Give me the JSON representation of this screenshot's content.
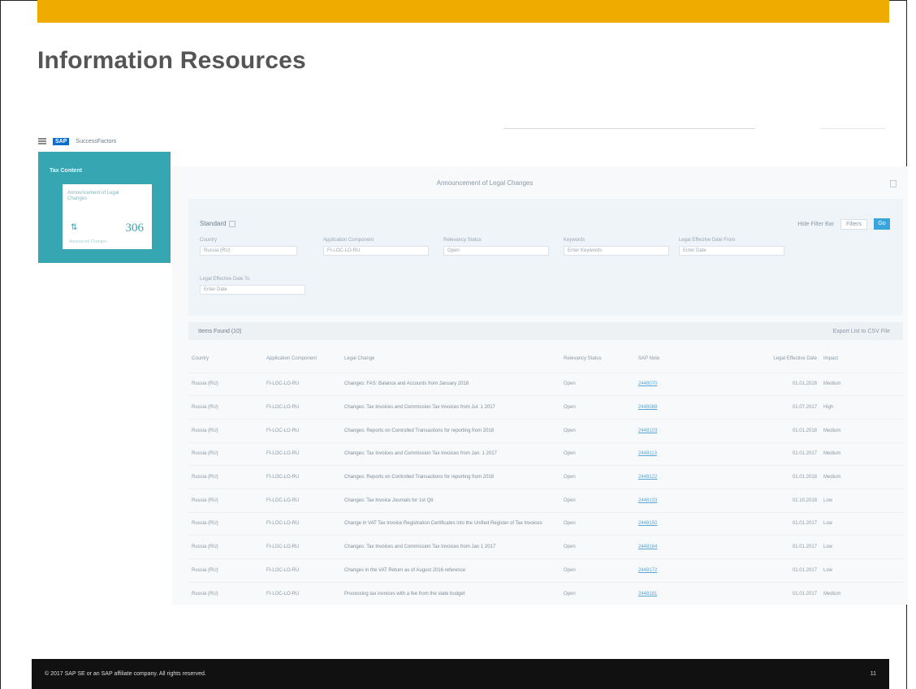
{
  "slide": {
    "title": "Information Resources",
    "footer": "© 2017 SAP SE or an SAP affiliate company. All rights reserved.",
    "page_number": "11"
  },
  "app": {
    "logo": "SAP",
    "name": "SuccessFactors",
    "panel_title": "Announcement of Legal Changes"
  },
  "tile": {
    "title": "Tax Content",
    "subtitle": "Announcement of Legal Changes",
    "count": "306",
    "trend_icon": "trend-arrow-icon",
    "footer": "Announced Changes"
  },
  "filterbar": {
    "variant": "Standard",
    "hide_filter_bar": "Hide Filter Bar",
    "filters_label": "Filters",
    "go_label": "Go",
    "fields": [
      {
        "label": "Country",
        "value": "Russia (RU)"
      },
      {
        "label": "Application Component",
        "value": "FI-LOC-LO-RU"
      },
      {
        "label": "Relevancy Status",
        "value": "Open"
      },
      {
        "label": "Keywords",
        "value": "Enter Keywords"
      },
      {
        "label": "Legal Effective Date From",
        "value": "Enter Date"
      },
      {
        "label": "Legal Effective Date To",
        "value": "Enter Date"
      }
    ]
  },
  "table": {
    "items_found": "Items Found (10)",
    "export": "Export List to CSV File",
    "columns": [
      "Country",
      "Application Component",
      "Legal Change",
      "Relevancy Status",
      "SAP Note",
      "Legal Effective Date",
      "Impact"
    ],
    "rows": [
      [
        "Russia (RU)",
        "FI-LOC-LO-RU",
        "Changes: FAS: Balance and Accounts from January 2018",
        "Open",
        "2448070",
        "01.01.2018",
        "Medium"
      ],
      [
        "Russia (RU)",
        "FI-LOC-LO-RU",
        "Changes: Tax Invoices and Commission Tax Invoices from Jul. 1 2017",
        "Open",
        "2448088",
        "01.07.2017",
        "High"
      ],
      [
        "Russia (RU)",
        "FI-LOC-LO-RU",
        "Changes: Reports on Controlled Transactions for reporting from 2018",
        "Open",
        "2448103",
        "01.01.2018",
        "Medium"
      ],
      [
        "Russia (RU)",
        "FI-LOC-LO-RU",
        "Changes: Tax Invoices and Commission Tax Invoices from Jan. 1 2017",
        "Open",
        "2448113",
        "01.01.2017",
        "Medium"
      ],
      [
        "Russia (RU)",
        "FI-LOC-LO-RU",
        "Changes: Reports on Controlled Transactions for reporting from 2018",
        "Open",
        "2448122",
        "01.01.2018",
        "Medium"
      ],
      [
        "Russia (RU)",
        "FI-LOC-LO-RU",
        "Changes: Tax Invoice Journals for 1st Qtr",
        "Open",
        "2448133",
        "01.10.2018",
        "Low"
      ],
      [
        "Russia (RU)",
        "FI-LOC-LO-RU",
        "Change in VAT Tax Invoice Registration Certificates into the Unified Register of Tax Invoices",
        "Open",
        "2448150",
        "01.01.2017",
        "Low"
      ],
      [
        "Russia (RU)",
        "FI-LOC-LO-RU",
        "Changes: Tax Invoices and Commission Tax Invoices from Jan 1 2017",
        "Open",
        "2448164",
        "01.01.2017",
        "Low"
      ],
      [
        "Russia (RU)",
        "FI-LOC-LO-RU",
        "Changes in the VAT Return as of August 2016 reference",
        "Open",
        "2448172",
        "01.01.2017",
        "Low"
      ],
      [
        "Russia (RU)",
        "FI-LOC-LO-RU",
        "Processing tax invoices with a fee from the state budget",
        "Open",
        "2448181",
        "01.01.2017",
        "Medium"
      ]
    ]
  },
  "colors": {
    "top_bar": "#f0ab00",
    "tile": "#37a6b3",
    "go_button": "#3aa4dc",
    "link": "#5aa6d4"
  }
}
